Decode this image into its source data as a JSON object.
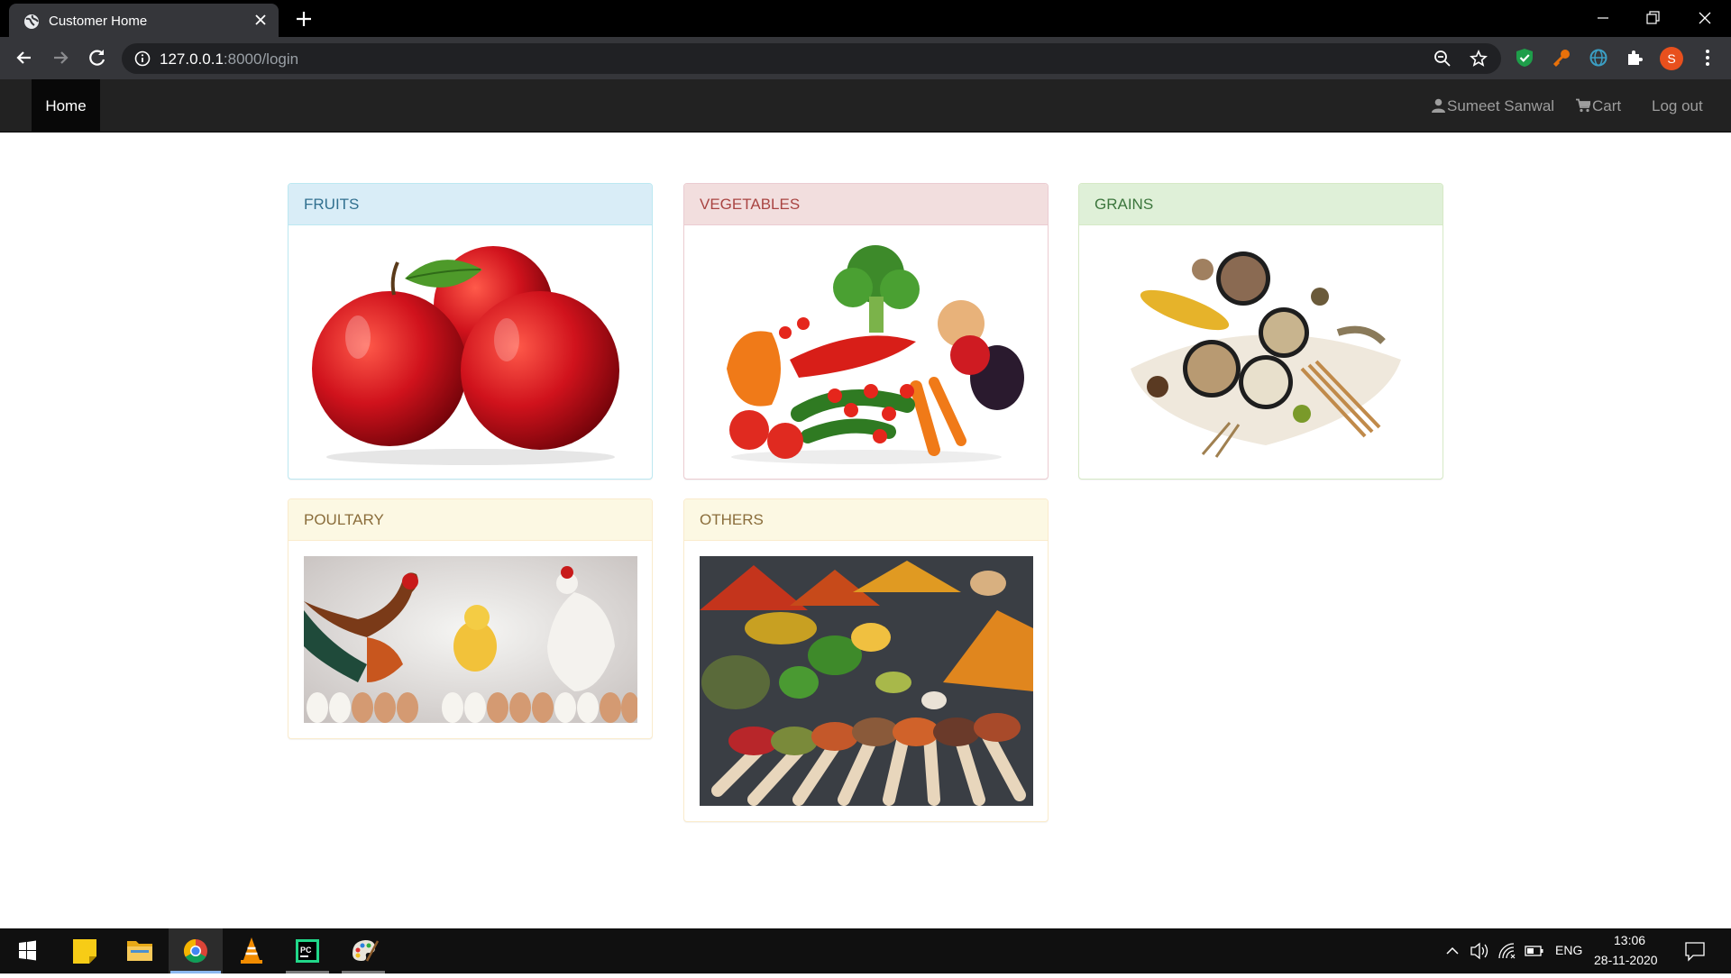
{
  "browser": {
    "tab_title": "Customer Home",
    "url_host": "127.0.0.1",
    "url_path": ":8000/login",
    "profile_initial": "S"
  },
  "navbar": {
    "home": "Home",
    "user": "Sumeet Sanwal",
    "cart": "Cart",
    "logout": "Log out"
  },
  "categories": [
    {
      "title": "FRUITS",
      "style": "info",
      "image": "apples"
    },
    {
      "title": "VEGETABLES",
      "style": "danger",
      "image": "vegetables"
    },
    {
      "title": "GRAINS",
      "style": "success",
      "image": "grains"
    },
    {
      "title": "POULTARY",
      "style": "warning",
      "image": "chickens-and-eggs"
    },
    {
      "title": "OTHERS",
      "style": "warning",
      "image": "spices"
    }
  ],
  "taskbar": {
    "language": "ENG",
    "time": "13:06",
    "date": "28-11-2020"
  },
  "colors": {
    "navbar_bg": "#222222",
    "info": "#d9edf7",
    "danger": "#f2dede",
    "success": "#dff0d8",
    "warning": "#fcf8e3"
  }
}
